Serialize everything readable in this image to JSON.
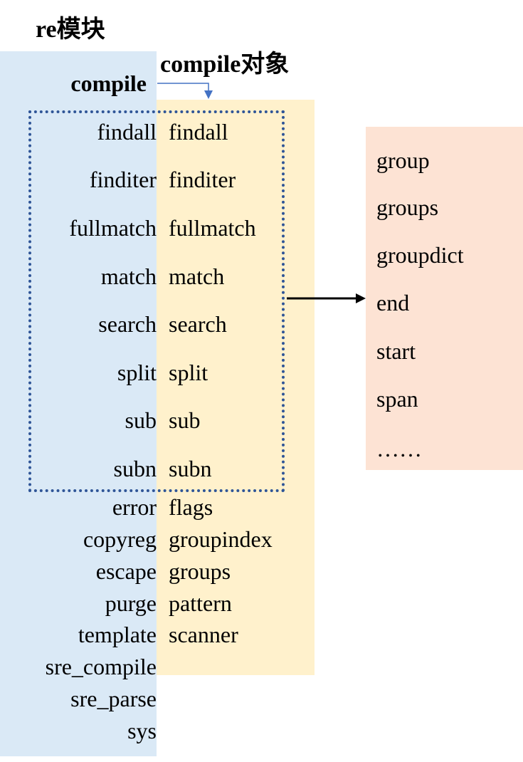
{
  "re_module": {
    "title": "re模块",
    "compile_label": "compile",
    "items": [
      "findall",
      "finditer",
      "fullmatch",
      "match",
      "search",
      "split",
      "sub",
      "subn",
      "error",
      "copyreg",
      "escape",
      "purge",
      "template",
      "sre_compile",
      "sre_parse",
      "sys"
    ]
  },
  "compile_object": {
    "title": "compile对象",
    "items": [
      "findall",
      "finditer",
      "fullmatch",
      "match",
      "search",
      "split",
      "sub",
      "subn",
      "flags",
      "groupindex",
      "groups",
      "pattern",
      "scanner"
    ]
  },
  "match_object": {
    "items": [
      "group",
      "groups",
      "groupdict",
      "end",
      "start",
      "span",
      "……"
    ]
  },
  "colors": {
    "re_bg": "#dae9f6",
    "compile_bg": "#fff1cc",
    "match_bg": "#fde3d4",
    "dotted_box": "#2f5597",
    "connector": "#4472c4"
  }
}
